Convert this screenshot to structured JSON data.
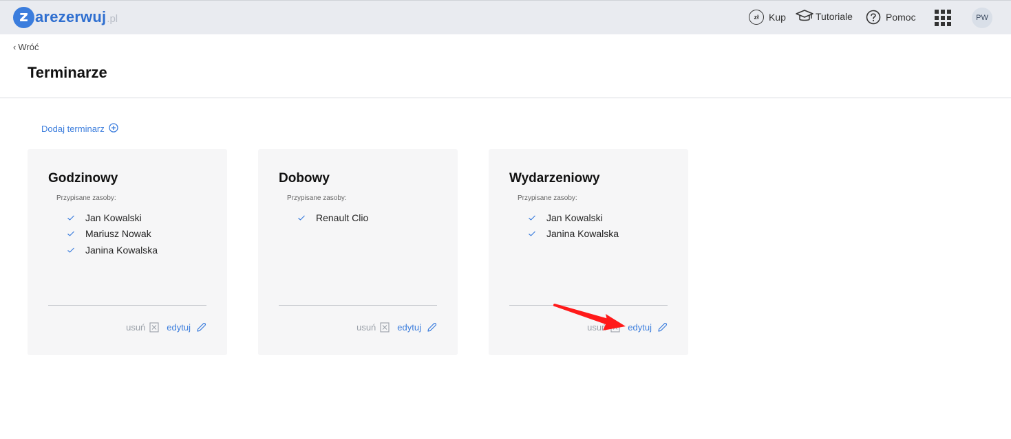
{
  "brand": {
    "logo_letter": "z",
    "logo_text": "arezerwuj",
    "logo_suffix": ".pl",
    "colors": {
      "accent": "#3b7ddd",
      "topbar": "#e9ebf0",
      "annotation": "#ff1a1a"
    }
  },
  "nav": {
    "buy_label": "Kup",
    "buy_icon_text": "zł",
    "tutorials_label": "Tutoriale",
    "help_label": "Pomoc",
    "avatar_initials": "PW"
  },
  "back_label": "Wróć",
  "page_title": "Terminarze",
  "add_label": "Dodaj terminarz",
  "assigned_label": "Przypisane zasoby:",
  "delete_label": "usuń",
  "edit_label": "edytuj",
  "cards": [
    {
      "title": "Godzinowy",
      "resources": [
        "Jan Kowalski",
        "Mariusz Nowak",
        "Janina Kowalska"
      ]
    },
    {
      "title": "Dobowy",
      "resources": [
        "Renault Clio"
      ]
    },
    {
      "title": "Wydarzeniowy",
      "resources": [
        "Jan Kowalski",
        "Janina Kowalska"
      ]
    }
  ]
}
